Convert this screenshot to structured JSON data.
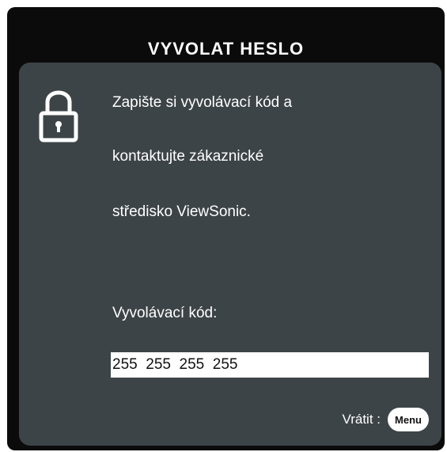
{
  "dialog": {
    "title": "VYVOLAT HESLO",
    "message_lines": [
      "Zapište si vyvolávací kód a",
      "kontaktujte zákaznické",
      "středisko ViewSonic."
    ],
    "code_label": "Vyvolávací kód:",
    "code_value": "255  255  255  255",
    "return_label": "Vrátit :",
    "menu_button_label": "Menu",
    "lock_icon": "lock-icon"
  },
  "colors": {
    "background": "#0b0b0b",
    "panel": "#3d4448",
    "text": "#ffffff"
  }
}
